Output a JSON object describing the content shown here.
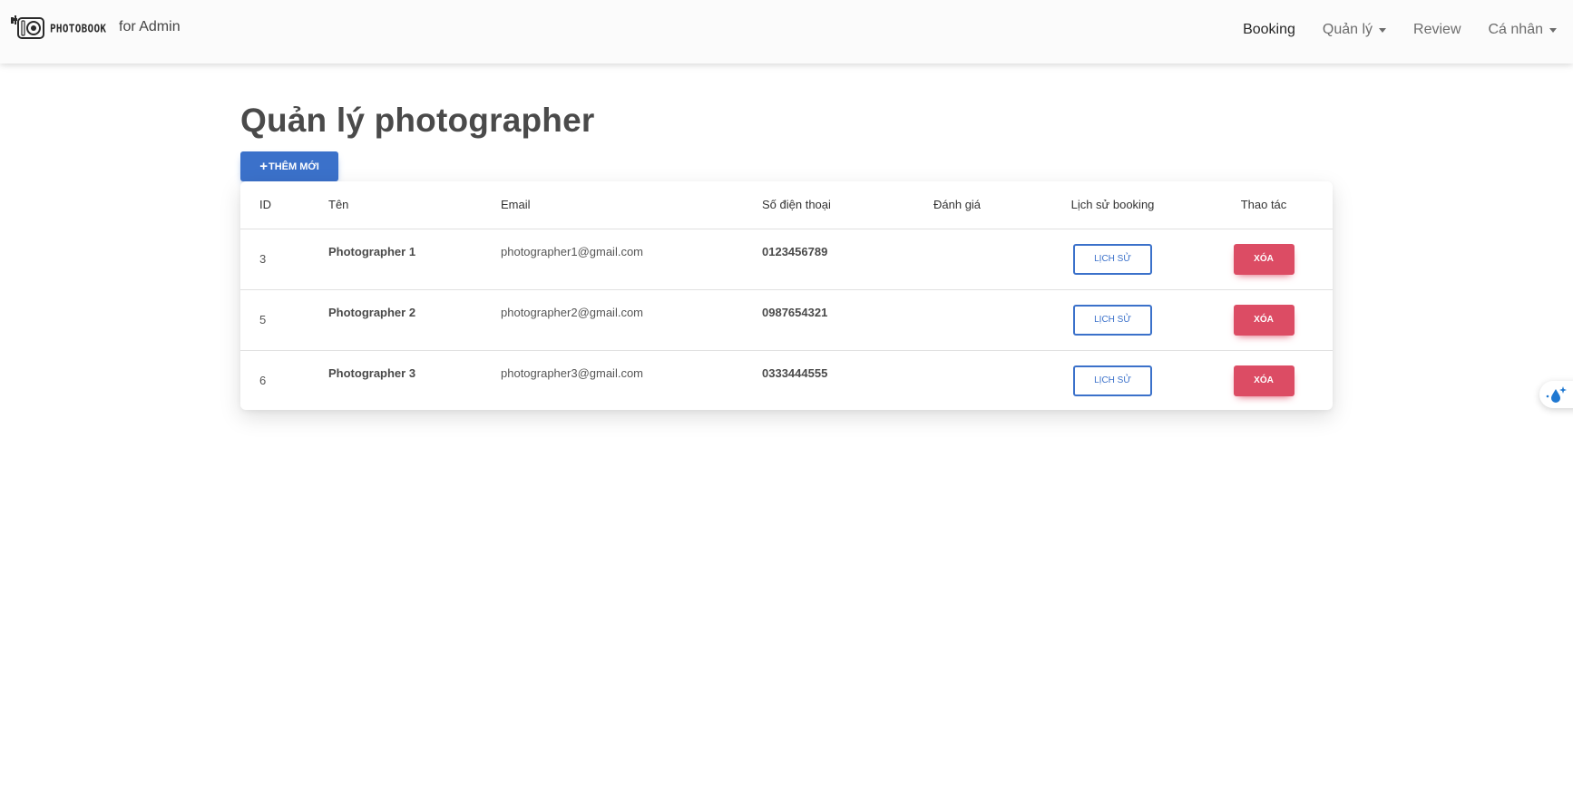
{
  "navbar": {
    "brand_text": "PHOTOBOOK",
    "brand_subtitle": "for Admin",
    "items": [
      {
        "label": "Booking",
        "active": true,
        "dropdown": false
      },
      {
        "label": "Quản lý",
        "active": false,
        "dropdown": true
      },
      {
        "label": "Review",
        "active": false,
        "dropdown": false
      },
      {
        "label": "Cá nhân",
        "active": false,
        "dropdown": true
      }
    ]
  },
  "main": {
    "title": "Quản lý photographer",
    "add_button_label": "THÊM MỚI",
    "table": {
      "headers": {
        "id": "ID",
        "name": "Tên",
        "email": "Email",
        "phone": "Số điện thoại",
        "rating": "Đánh giá",
        "history": "Lịch sử booking",
        "actions": "Thao tác"
      },
      "rows": [
        {
          "id": "3",
          "name": "Photographer 1",
          "email": "photographer1@gmail.com",
          "phone": "0123456789",
          "rating": "",
          "history_label": "LỊCH SỬ",
          "delete_label": "XÓA"
        },
        {
          "id": "5",
          "name": "Photographer 2",
          "email": "photographer2@gmail.com",
          "phone": "0987654321",
          "rating": "",
          "history_label": "LỊCH SỬ",
          "delete_label": "XÓA"
        },
        {
          "id": "6",
          "name": "Photographer 3",
          "email": "photographer3@gmail.com",
          "phone": "0333444555",
          "rating": "",
          "history_label": "LỊCH SỬ",
          "delete_label": "XÓA"
        }
      ]
    }
  },
  "icons": {
    "brand_logo": "camera-icon",
    "add_button": "plus-icon",
    "dropdown": "caret-down-icon",
    "float_widget": "water-drop-sparkle-icon"
  },
  "colors": {
    "primary": "#3b71ca",
    "danger": "#dc4c64",
    "navbar_bg": "#fbfbfb"
  }
}
